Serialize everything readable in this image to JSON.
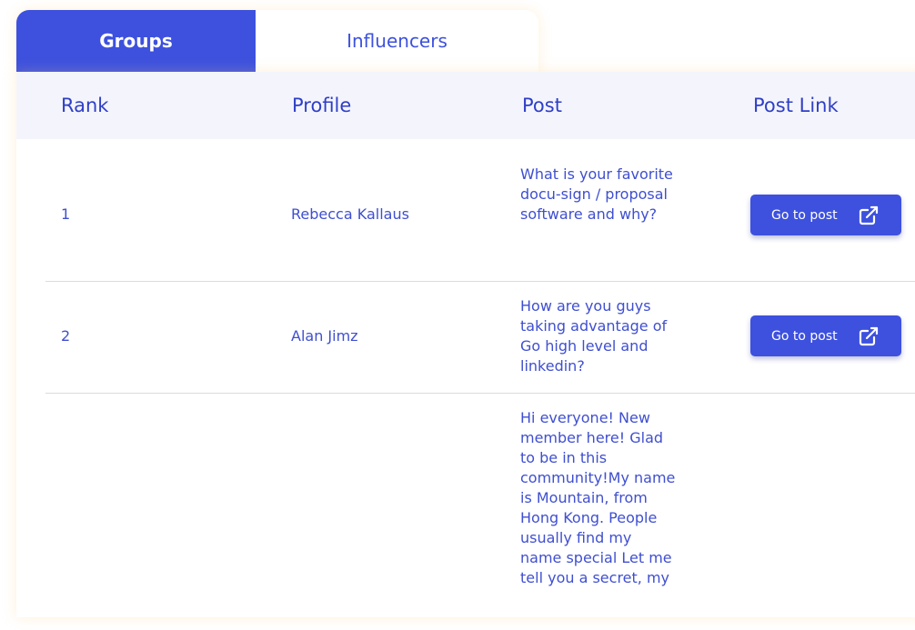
{
  "tabs": [
    {
      "label": "Groups",
      "active": true
    },
    {
      "label": "Influencers",
      "active": false
    }
  ],
  "table": {
    "headers": [
      "Rank",
      "Profile",
      "Post",
      "Post Link"
    ],
    "rows": [
      {
        "rank": "1",
        "profile": "Rebecca Kallaus",
        "post": "What is your favorite docu-sign / proposal software and why?",
        "link_label": "Go to post",
        "link_icon": "external-link-icon"
      },
      {
        "rank": "2",
        "profile": "Alan Jimz",
        "post": "How are you guys taking advantage of Go high level and linkedin?",
        "link_label": "Go to post",
        "link_icon": "external-link-icon"
      },
      {
        "rank": "",
        "profile": "",
        "post": "Hi everyone! New member here! Glad to be in this community!My name is Mountain, from Hong Kong. People usually find my name special Let me tell you a secret, my",
        "link_label": "",
        "link_icon": ""
      }
    ]
  },
  "colors": {
    "accent": "#3d51de",
    "header_bg": "#f4f5fc",
    "text": "#3f4fd0",
    "divider": "#dadbe2"
  }
}
